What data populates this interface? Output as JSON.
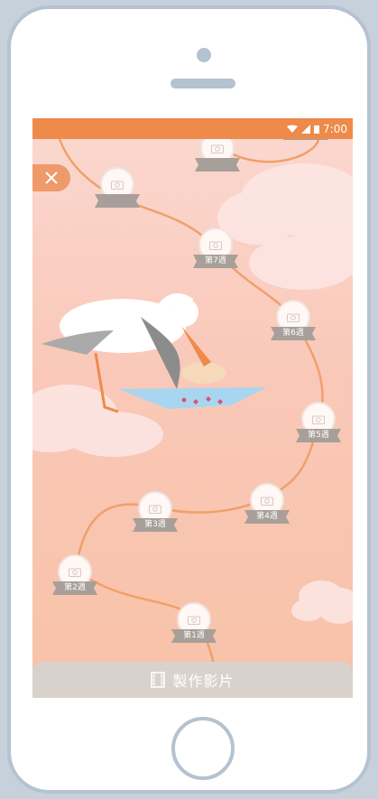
{
  "status_bar": {
    "time": "7:00"
  },
  "close_button": {
    "icon": "close-icon"
  },
  "weeks": [
    {
      "label": ""
    },
    {
      "label": ""
    },
    {
      "label": "第7週"
    },
    {
      "label": "第6週"
    },
    {
      "label": "第5週"
    },
    {
      "label": "第4週"
    },
    {
      "label": "第3週"
    },
    {
      "label": "第2週"
    },
    {
      "label": "第1週"
    }
  ],
  "bottom_bar": {
    "label": "製作影片",
    "icon": "film-icon"
  },
  "colors": {
    "accent": "#ee8a4a",
    "path": "#f0a06a",
    "ribbon": "#a79f99",
    "background_top": "#fbd8d0",
    "background_bottom": "#f8c2a7"
  }
}
